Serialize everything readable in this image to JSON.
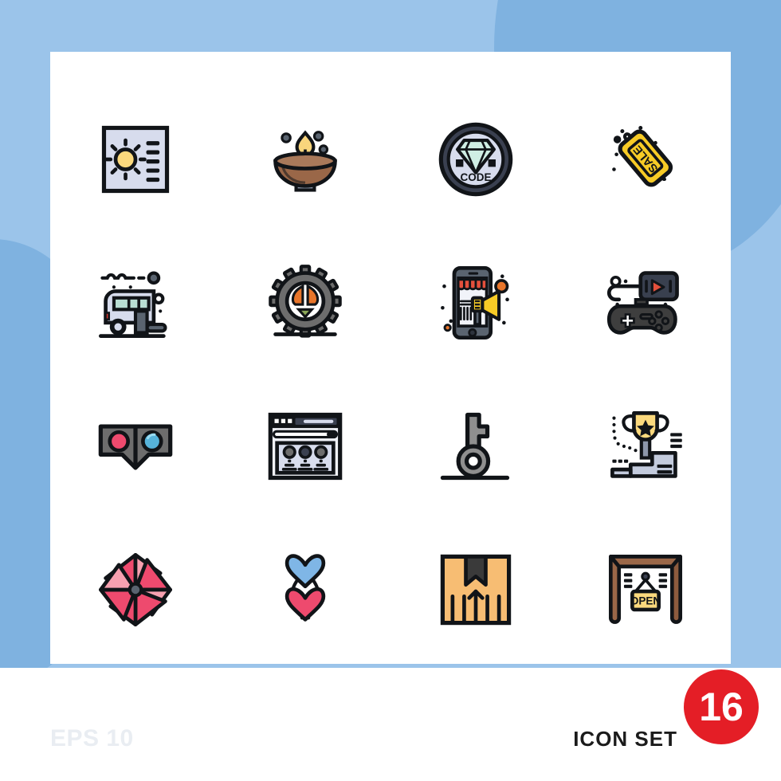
{
  "meta": {
    "background_color": "#9bc4ea",
    "blob_color": "#7fb2e0",
    "card_color": "#ffffff"
  },
  "footer": {
    "eps_label": "EPS 10",
    "icon_set_label": "ICON SET",
    "count": "16",
    "badge_color": "#e41e26",
    "eps_color": "#e9edf2",
    "icon_set_color": "#1b1b1b"
  },
  "grid": {
    "columns": 4,
    "rows": 4,
    "total": 16,
    "icons": [
      {
        "index": 1,
        "name": "brightness-settings-icon",
        "label": "Brightness",
        "colors": [
          "#d7dced",
          "#fbd97d",
          "#111418"
        ]
      },
      {
        "index": 2,
        "name": "diya-oil-lamp-icon",
        "label": "Diya Lamp",
        "colors": [
          "#9a6748",
          "#f9d57c",
          "#5a6470"
        ]
      },
      {
        "index": 3,
        "name": "code-diamond-badge-icon",
        "label": "Code",
        "colors": [
          "#d7dced",
          "#cfeee4",
          "#3a4050"
        ],
        "text": "CODE"
      },
      {
        "index": 4,
        "name": "sale-tag-icon",
        "label": "Sale Tag",
        "colors": [
          "#f7cb26",
          "#111418",
          "#d1332e"
        ],
        "text": "SALE"
      },
      {
        "index": 5,
        "name": "caravan-trailer-icon",
        "label": "Caravan",
        "colors": [
          "#d7dced",
          "#b9ded3",
          "#5a6470"
        ]
      },
      {
        "index": 6,
        "name": "peace-gear-icon",
        "label": "Peace Gear",
        "colors": [
          "#6d6d6d",
          "#e8752a",
          "#8ba758"
        ]
      },
      {
        "index": 7,
        "name": "mobile-marketing-icon",
        "label": "Mobile Marketing",
        "colors": [
          "#5a6470",
          "#e4503c",
          "#f7cb26"
        ]
      },
      {
        "index": 8,
        "name": "game-controller-icon",
        "label": "Game Controller",
        "colors": [
          "#3e3e3e",
          "#39404f",
          "#e4503c"
        ]
      },
      {
        "index": 9,
        "name": "vr-glasses-icon",
        "label": "VR Glasses",
        "colors": [
          "#6d6d6d",
          "#ee4a6e",
          "#56b3da"
        ]
      },
      {
        "index": 10,
        "name": "browser-team-page-icon",
        "label": "Team Page",
        "colors": [
          "#f1f3f9",
          "#d7dced",
          "#111418"
        ]
      },
      {
        "index": 11,
        "name": "key-icon",
        "label": "Key",
        "colors": [
          "#8f8f8f",
          "#111418"
        ]
      },
      {
        "index": 12,
        "name": "trophy-podium-icon",
        "label": "Trophy Podium",
        "colors": [
          "#fbd97d",
          "#c3cbdd",
          "#8d97aa"
        ]
      },
      {
        "index": 13,
        "name": "pinwheel-icon",
        "label": "Pinwheel",
        "colors": [
          "#ee4a6e",
          "#f7a0b0",
          "#5a6470"
        ]
      },
      {
        "index": 14,
        "name": "double-heart-icon",
        "label": "Double Heart",
        "colors": [
          "#7fb6e6",
          "#ee4a6e"
        ]
      },
      {
        "index": 15,
        "name": "delivery-box-icon",
        "label": "Delivery Box",
        "colors": [
          "#f7bd73",
          "#3a3a3a"
        ]
      },
      {
        "index": 16,
        "name": "open-sign-icon",
        "label": "Open Sign",
        "colors": [
          "#9a6748",
          "#fbd97d"
        ],
        "text": "OPEN"
      }
    ]
  }
}
